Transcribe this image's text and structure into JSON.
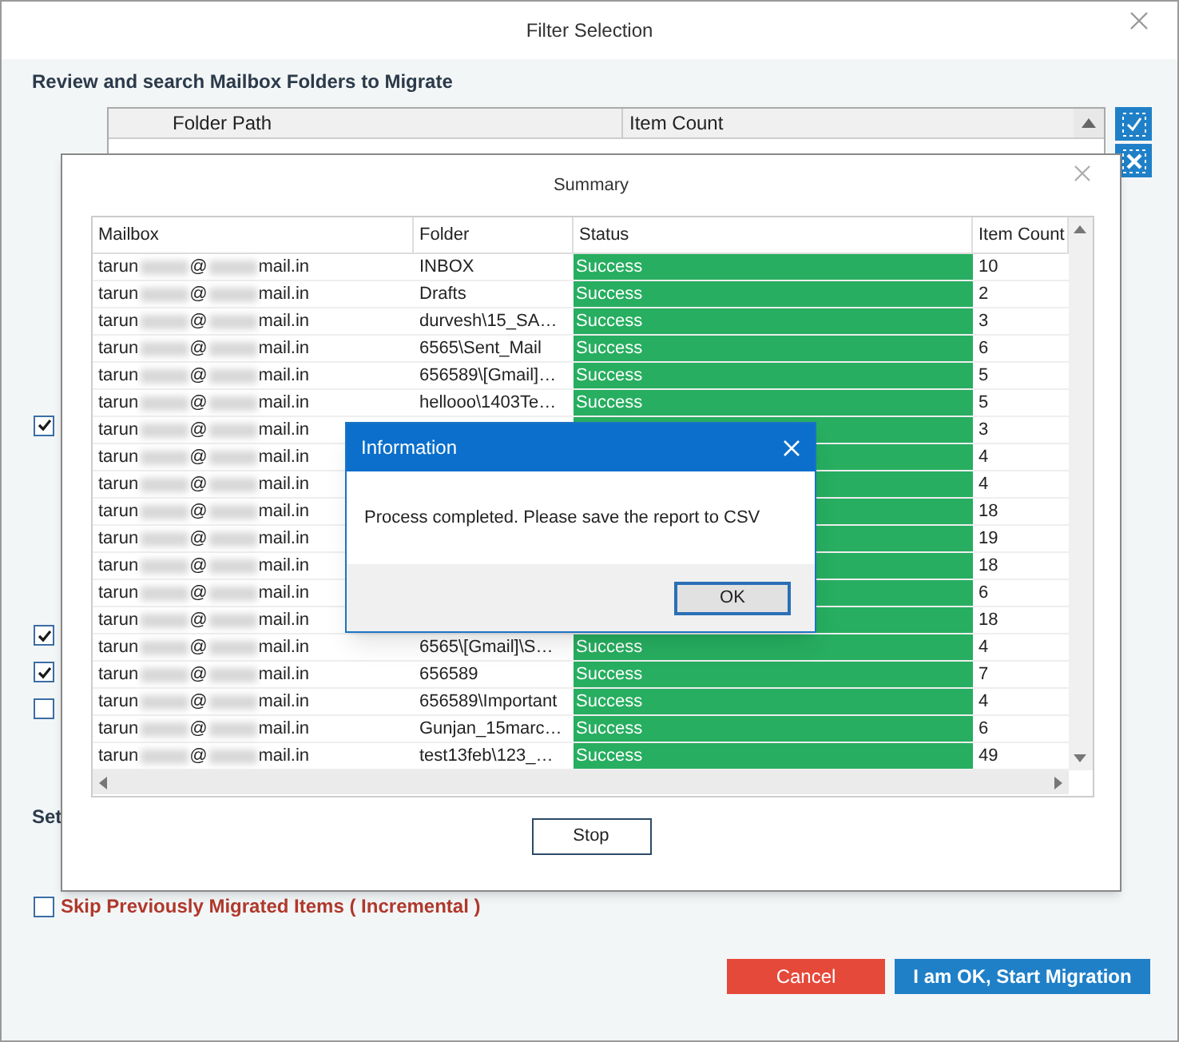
{
  "window": {
    "title": "Filter Selection",
    "heading": "Review and search Mailbox Folders to Migrate"
  },
  "folder_table": {
    "columns": [
      "Folder Path",
      "Item Count"
    ]
  },
  "side_buttons": [
    {
      "kind": "check"
    },
    {
      "kind": "clear"
    }
  ],
  "options": [
    {
      "checked": true
    },
    {
      "checked": true
    },
    {
      "checked": true
    },
    {
      "checked": false
    }
  ],
  "settings_heading": "Set",
  "incremental": {
    "label": "Skip Previously Migrated Items ( Incremental )",
    "checked": false
  },
  "buttons": [
    {
      "label": "Cancel",
      "kind": "cancel"
    },
    {
      "label": "I am OK, Start Migration",
      "kind": "primary"
    }
  ],
  "summary": {
    "title": "Summary",
    "columns": [
      "Mailbox",
      "Folder",
      "Status",
      "Item Count"
    ],
    "rows": [
      {
        "mailbox": [
          "tarun",
          "@",
          "mail.in"
        ],
        "folder": "INBOX",
        "status": "Success",
        "kind": "success",
        "count": "10"
      },
      {
        "mailbox": [
          "tarun",
          "@",
          "mail.in"
        ],
        "folder": "Drafts",
        "status": "Success",
        "kind": "success",
        "count": "2"
      },
      {
        "mailbox": [
          "tarun",
          "@",
          "mail.in"
        ],
        "folder": "durvesh\\15_SA…",
        "status": "Success",
        "kind": "success",
        "count": "3"
      },
      {
        "mailbox": [
          "tarun",
          "@",
          "mail.in"
        ],
        "folder": "6565\\Sent_Mail",
        "status": "Success",
        "kind": "success",
        "count": "6"
      },
      {
        "mailbox": [
          "tarun",
          "@",
          "mail.in"
        ],
        "folder": "656589\\[Gmail]…",
        "status": "Success",
        "kind": "success",
        "count": "5"
      },
      {
        "mailbox": [
          "tarun",
          "@",
          "mail.in"
        ],
        "folder": "hellooo\\1403Te…",
        "status": "Success",
        "kind": "success",
        "count": "5"
      },
      {
        "mailbox": [
          "tarun",
          "@",
          "mail.in"
        ],
        "kind": "success",
        "count": "3"
      },
      {
        "mailbox": [
          "tarun",
          "@",
          "mail.in"
        ],
        "kind": "success",
        "count": "4"
      },
      {
        "mailbox": [
          "tarun",
          "@",
          "mail.in"
        ],
        "kind": "success",
        "count": "4"
      },
      {
        "mailbox": [
          "tarun",
          "@",
          "mail.in"
        ],
        "kind": "success",
        "count": "18"
      },
      {
        "mailbox": [
          "tarun",
          "@",
          "mail.in"
        ],
        "kind": "success",
        "count": "19"
      },
      {
        "mailbox": [
          "tarun",
          "@",
          "mail.in"
        ],
        "kind": "success",
        "count": "18"
      },
      {
        "mailbox": [
          "tarun",
          "@",
          "mail.in"
        ],
        "kind": "success",
        "count": "6"
      },
      {
        "mailbox": [
          "tarun",
          "@",
          "mail.in"
        ],
        "kind": "success",
        "count": "18"
      },
      {
        "mailbox": [
          "tarun",
          "@",
          "mail.in"
        ],
        "folder": "6565\\[Gmail]\\S…",
        "status": "Success",
        "kind": "success",
        "count": "4"
      },
      {
        "mailbox": [
          "tarun",
          "@",
          "mail.in"
        ],
        "folder": "656589",
        "status": "Success",
        "kind": "success",
        "count": "7"
      },
      {
        "mailbox": [
          "tarun",
          "@",
          "mail.in"
        ],
        "folder": "656589\\Important",
        "status": "Success",
        "kind": "success",
        "count": "4"
      },
      {
        "mailbox": [
          "tarun",
          "@",
          "mail.in"
        ],
        "folder": "Gunjan_15marc…",
        "status": "Success",
        "kind": "success",
        "count": "6"
      },
      {
        "mailbox": [
          "tarun",
          "@",
          "mail.in"
        ],
        "folder": "test13feb\\123_…",
        "status": "Success",
        "kind": "success",
        "count": "49"
      }
    ],
    "stop_button": "Stop"
  },
  "info_dialog": {
    "title": "Information",
    "message": "Process completed. Please save the report to CSV",
    "ok_button": "OK"
  }
}
